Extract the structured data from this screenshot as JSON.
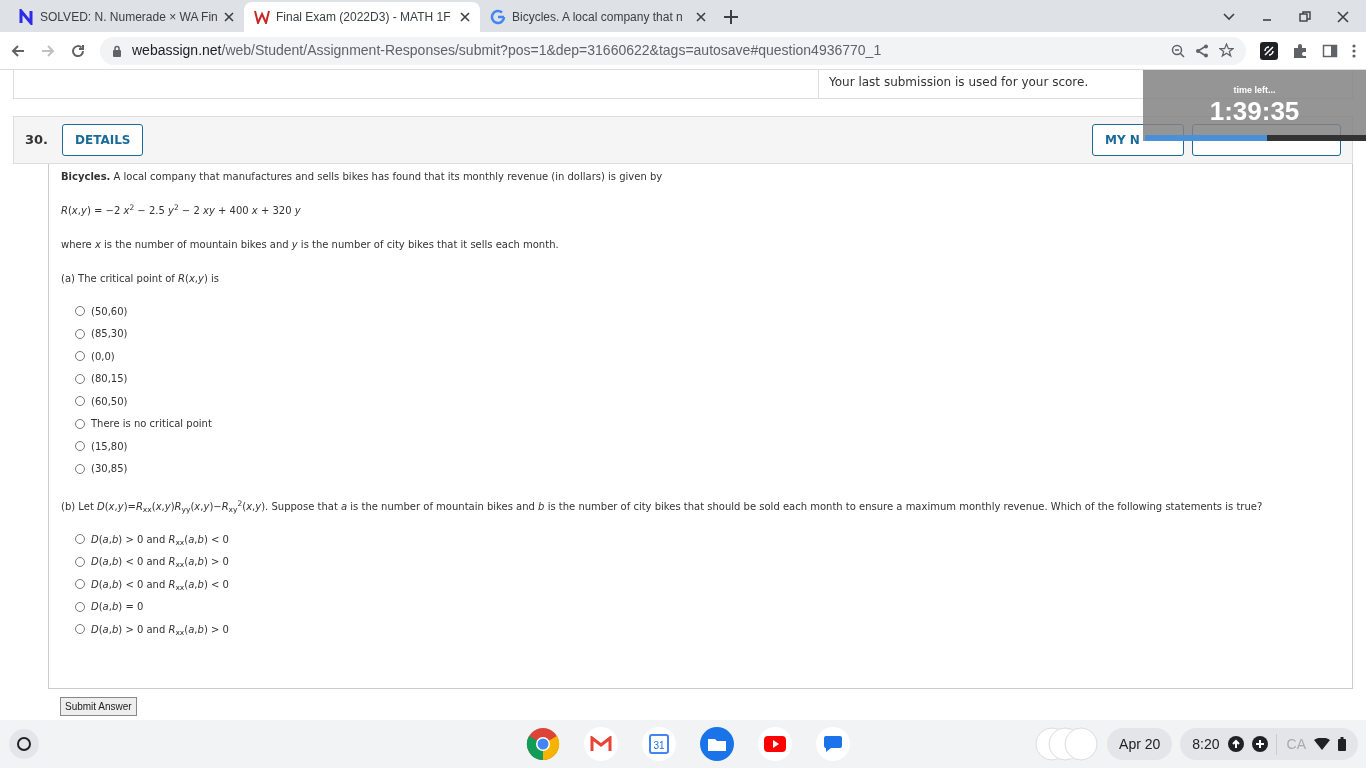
{
  "browser_tabs": [
    {
      "title": "SOLVED: N. Numerade × WA Fin",
      "selected": false,
      "kind": "numerade"
    },
    {
      "title": "Final Exam (2022D3) - MATH 1F",
      "selected": true,
      "kind": "webassign"
    },
    {
      "title": "Bicycles. A local company that n",
      "selected": false,
      "kind": "google"
    }
  ],
  "address_bar": {
    "domain": "webassign.net",
    "path": "/web/Student/Assignment-Responses/submit?pos=1&dep=31660622&tags=autosave#question4936770_1"
  },
  "notice": "Your last submission is used for your score.",
  "timer": {
    "label": "time left...",
    "time": "1:39:35",
    "level": 0.55
  },
  "question": {
    "number": "30.",
    "details_button": "DETAILS",
    "notes_button": "MY N",
    "intro": "**Bicycles.** A local company that manufactures and sells bikes has found that its monthly revenue (in dollars) is given by",
    "formula": "*R*(*x*,*y*) = −2 *x*$^{2}$ − 2.5 *y*$^{2}$ − 2 *xy* + 400 *x* + 320 *y*",
    "explanation": "where *x* is the number of mountain bikes and *y* is the number of city bikes that it sells each month.",
    "parts": [
      {
        "prompt": "(a) The critical point of *R*(*x*,*y*) is",
        "options": [
          {
            "text": "(50,60)",
            "selected": false
          },
          {
            "text": "(85,30)",
            "selected": false
          },
          {
            "text": "(0,0)",
            "selected": false
          },
          {
            "text": "(80,15)",
            "selected": false
          },
          {
            "text": "(60,50)",
            "selected": false
          },
          {
            "text": "There is no critical point",
            "selected": false
          },
          {
            "text": "(15,80)",
            "selected": false
          },
          {
            "text": "(30,85)",
            "selected": false
          }
        ]
      },
      {
        "prompt": "(b) Let *D*(*x*,*y*)=*R*$_{xx}$(*x*,*y*)*R*$_{yy}$(*x*,*y*)−*R*$_{xy}$$^{2}$(*x*,*y*). Suppose that *a* is the number of mountain bikes and *b* is the number of city bikes that should be sold each month to ensure a maximum monthly revenue. Which of the following statements is true?",
        "options": [
          {
            "text": "*D*(*a*,*b*) > 0 and *R*$_{xx}$(*a*,*b*) < 0",
            "selected": false
          },
          {
            "text": "*D*(*a*,*b*) < 0 and *R*$_{xx}$(*a*,*b*) > 0",
            "selected": false
          },
          {
            "text": "*D*(*a*,*b*) < 0 and *R*$_{xx}$(*a*,*b*) < 0",
            "selected": false
          },
          {
            "text": "*D*(*a*,*b*) = 0",
            "selected": false
          },
          {
            "text": "*D*(*a*,*b*) > 0 and *R*$_{xx}$(*a*,*b*) > 0",
            "selected": false
          }
        ]
      }
    ],
    "submit_button": "Submit Answer"
  },
  "shelf": {
    "calendar_day": "31",
    "date": "Apr 20",
    "time": "8:20",
    "ime": "CA"
  }
}
